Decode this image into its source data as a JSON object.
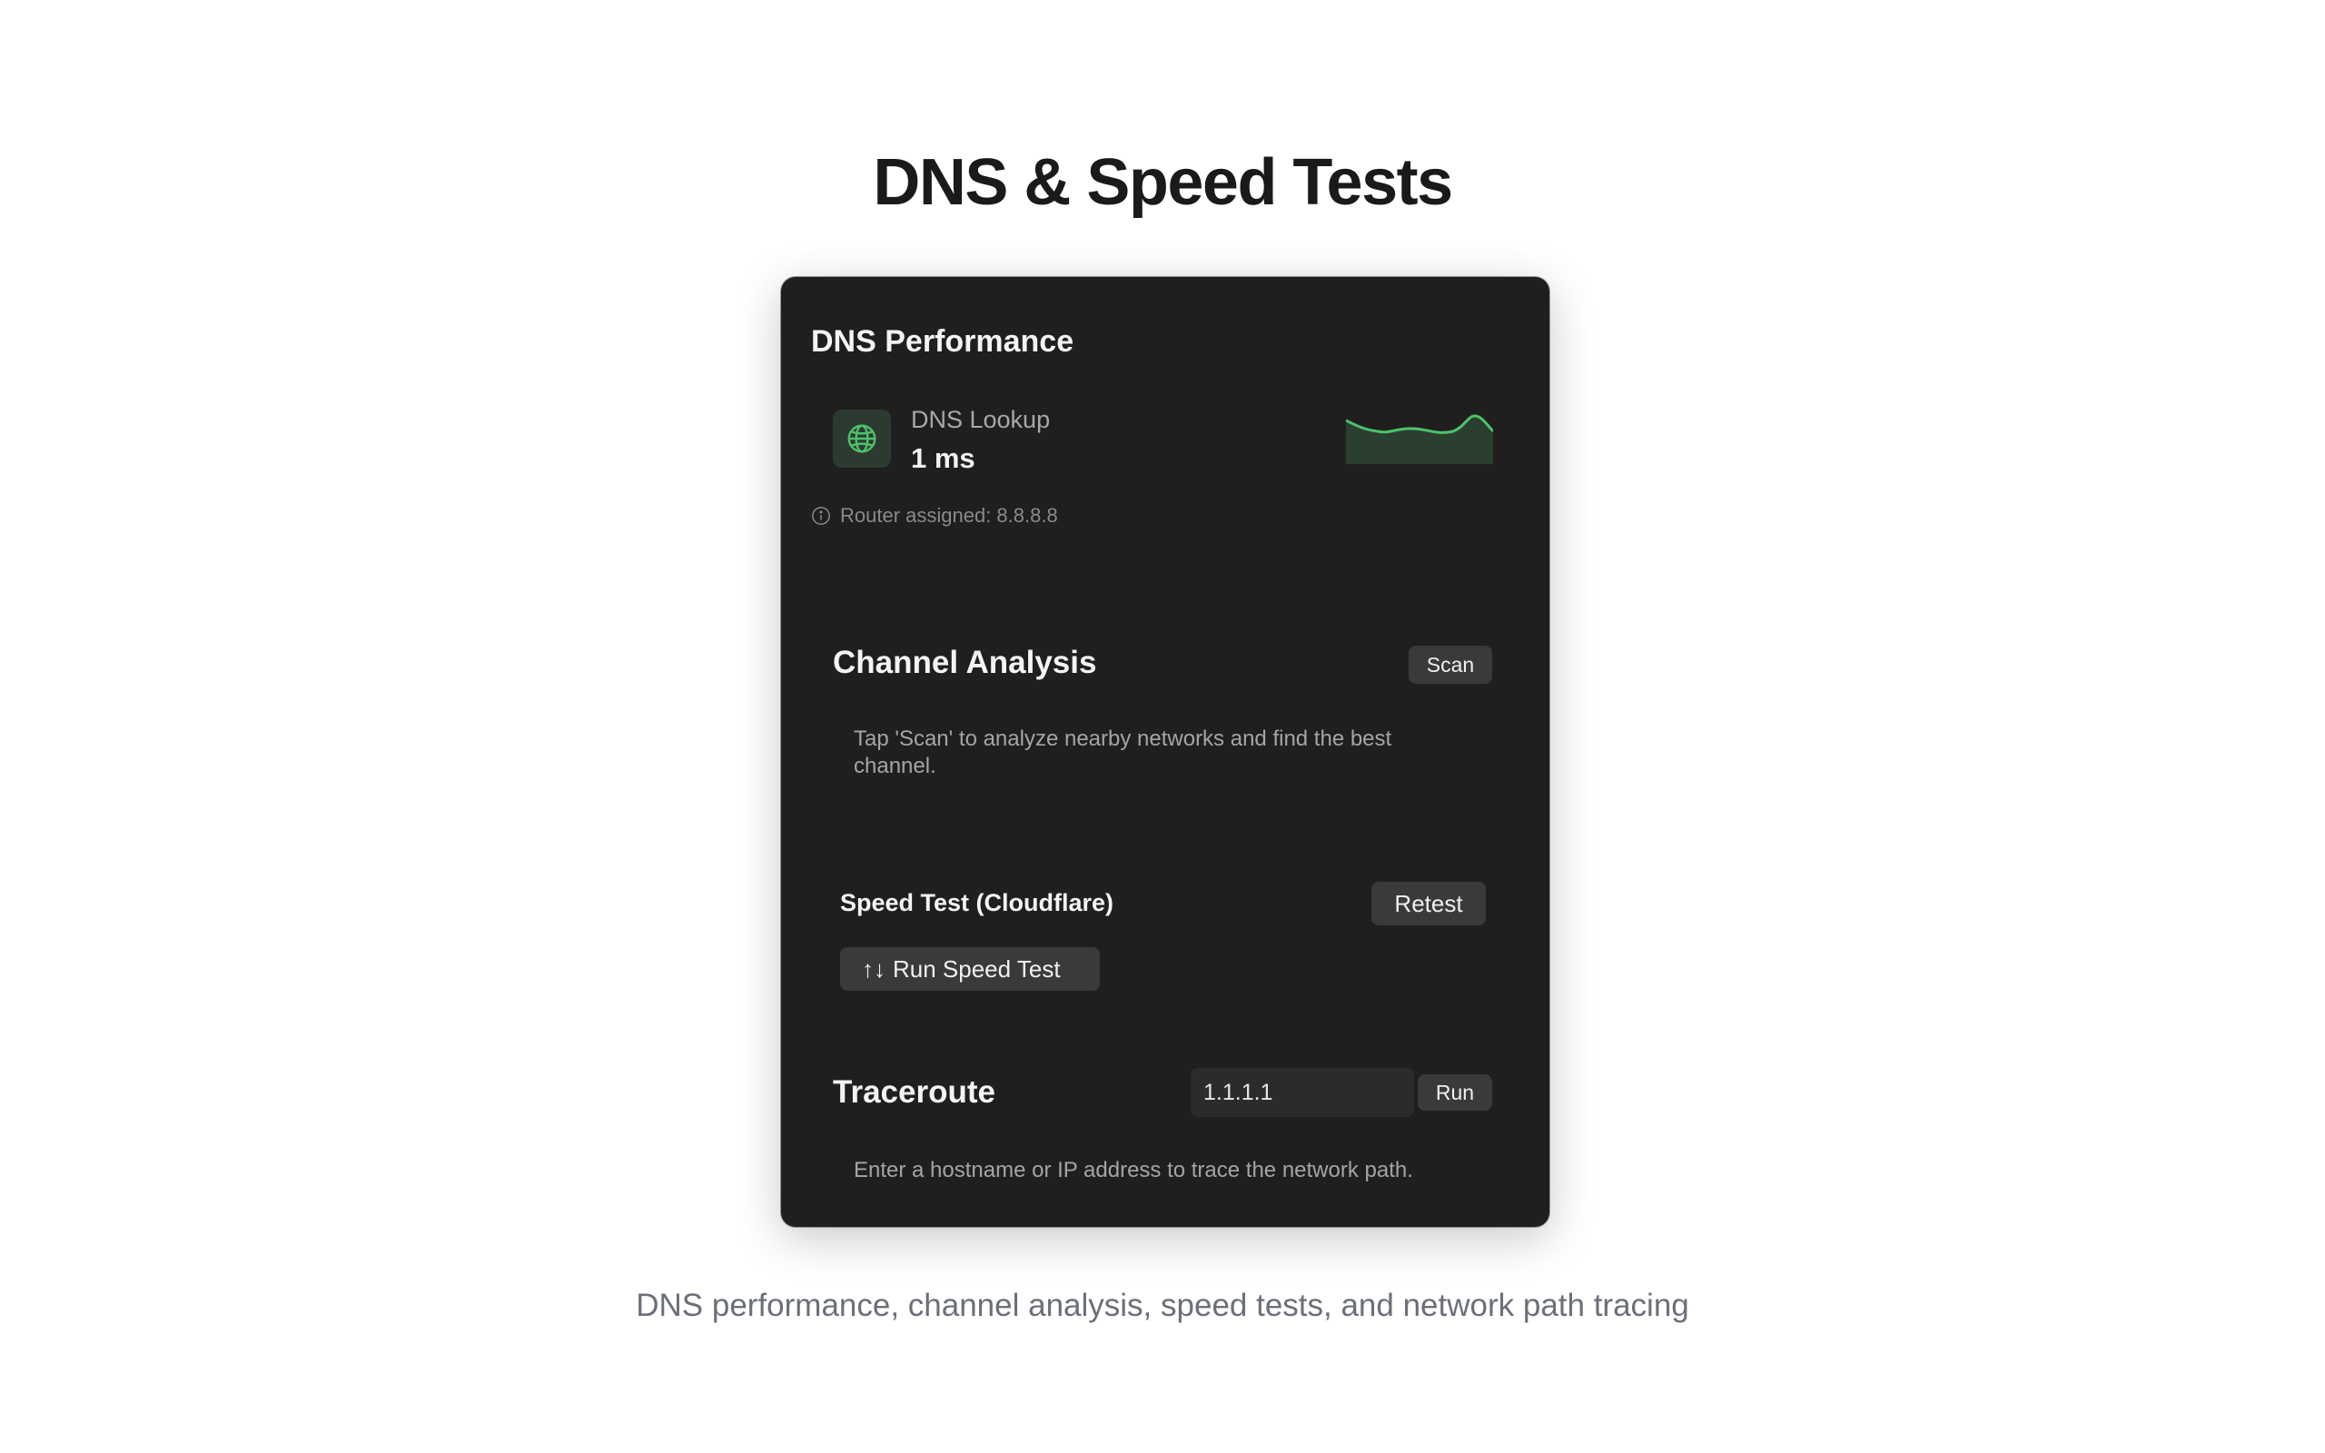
{
  "page": {
    "title": "DNS & Speed Tests",
    "caption": "DNS performance, channel analysis, speed tests, and network path tracing"
  },
  "dns": {
    "section_title": "DNS Performance",
    "lookup_label": "DNS Lookup",
    "lookup_value": "1 ms",
    "router_info": "Router assigned: 8.8.8.8",
    "icon": "globe-icon",
    "info_icon": "info-icon",
    "accent_color": "#4cc36a"
  },
  "channel": {
    "section_title": "Channel Analysis",
    "scan_label": "Scan",
    "description": "Tap 'Scan' to analyze nearby networks and find the best channel."
  },
  "speed_test": {
    "section_title": "Speed Test (Cloudflare)",
    "retest_label": "Retest",
    "run_label": "Run Speed Test",
    "run_icon": "↑↓"
  },
  "traceroute": {
    "section_title": "Traceroute",
    "input_value": "1.1.1.1",
    "run_label": "Run",
    "description": "Enter a hostname or IP address to trace the network path."
  },
  "colors": {
    "panel_bg": "#1f1f1f",
    "button_bg": "#3a3a3a",
    "accent_green": "#4cc36a"
  }
}
